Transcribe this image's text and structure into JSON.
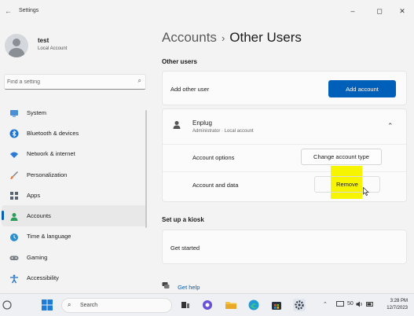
{
  "window": {
    "title": "Settings",
    "back_glyph": "←",
    "minimize_glyph": "–",
    "maximize_glyph": "◻",
    "close_glyph": "✕"
  },
  "profile": {
    "name": "test",
    "subtitle": "Local Account"
  },
  "search": {
    "placeholder": "Find a setting",
    "icon": "search-icon"
  },
  "sidebar": {
    "items": [
      {
        "label": "System",
        "icon": "monitor-icon",
        "color": "#4a8fd6"
      },
      {
        "label": "Bluetooth & devices",
        "icon": "bluetooth-icon",
        "color": "#1a73d9"
      },
      {
        "label": "Network & internet",
        "icon": "wifi-icon",
        "color": "#2a7bd5"
      },
      {
        "label": "Personalization",
        "icon": "brush-icon",
        "color": "#e07a3a"
      },
      {
        "label": "Apps",
        "icon": "apps-icon",
        "color": "#5a6470"
      },
      {
        "label": "Accounts",
        "icon": "person-icon",
        "color": "#2e9c5a",
        "selected": true
      },
      {
        "label": "Time & language",
        "icon": "globe-clock-icon",
        "color": "#2b8fd0"
      },
      {
        "label": "Gaming",
        "icon": "gamepad-icon",
        "color": "#7a7f88"
      },
      {
        "label": "Accessibility",
        "icon": "accessibility-icon",
        "color": "#1d6fd1"
      }
    ]
  },
  "breadcrumb": {
    "parent": "Accounts",
    "separator": "›",
    "current": "Other Users"
  },
  "other_users": {
    "heading": "Other users",
    "add_row": {
      "label": "Add other user",
      "button": "Add account"
    },
    "user": {
      "name": "Enplug",
      "details": "Administrator · Local account",
      "account_options_label": "Account options",
      "change_type_button": "Change account type",
      "account_data_label": "Account and data",
      "remove_button": "Remove"
    }
  },
  "kiosk": {
    "heading": "Set up a kiosk",
    "row_label": "Get started"
  },
  "help": {
    "label": "Get help"
  },
  "taskbar": {
    "search_label": "Search",
    "tray_volume": "50",
    "time": "3:28 PM",
    "date": "12/7/2023"
  },
  "colors": {
    "accent": "#005fb8",
    "highlight": "#f7f400"
  }
}
